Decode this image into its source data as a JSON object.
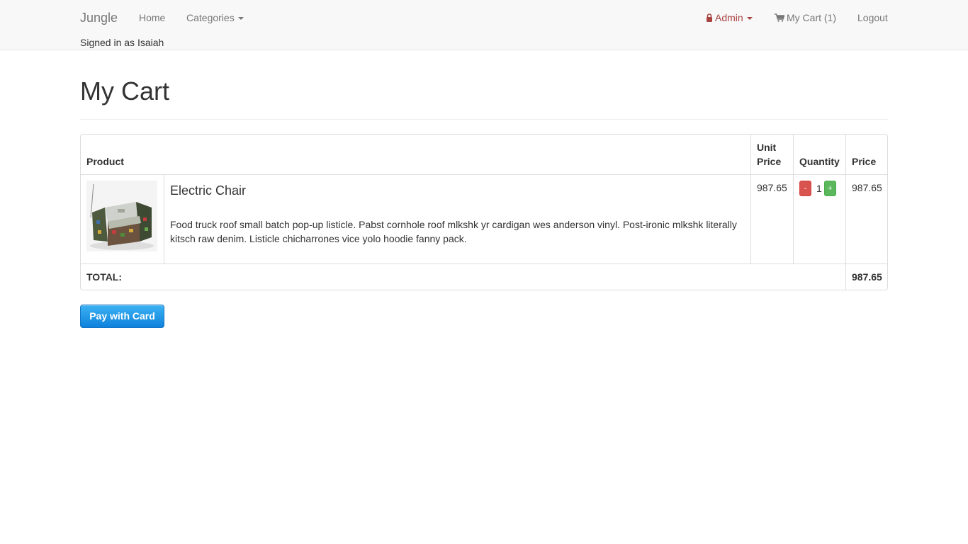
{
  "navbar": {
    "brand": "Jungle",
    "home": "Home",
    "categories": "Categories",
    "admin": "Admin",
    "cart": "My Cart (1)",
    "logout": "Logout",
    "signed_in": "Signed in as Isaiah"
  },
  "page": {
    "title": "My Cart"
  },
  "table": {
    "headers": {
      "product": "Product",
      "unit_price": "Unit Price",
      "quantity": "Quantity",
      "price": "Price"
    },
    "items": [
      {
        "name": "Electric Chair",
        "description": "Food truck roof small batch pop-up listicle. Pabst cornhole roof mlkshk yr cardigan wes anderson vinyl. Post-ironic mlkshk literally kitsch raw denim. Listicle chicharrones vice yolo hoodie fanny pack.",
        "unit_price": "987.65",
        "quantity": "1",
        "decrease_label": "-",
        "increase_label": "+",
        "price": "987.65"
      }
    ],
    "total_label": "TOTAL:",
    "total_value": "987.65"
  },
  "actions": {
    "pay": "Pay with Card"
  },
  "icons": {
    "admin": "lock-icon",
    "cart": "shopping-cart-icon",
    "dropdown": "caret-down-icon"
  },
  "colors": {
    "admin_text": "#a94442",
    "minus_button": "#d9534f",
    "plus_button": "#5cb85c",
    "pay_button": "#0e82dc"
  }
}
